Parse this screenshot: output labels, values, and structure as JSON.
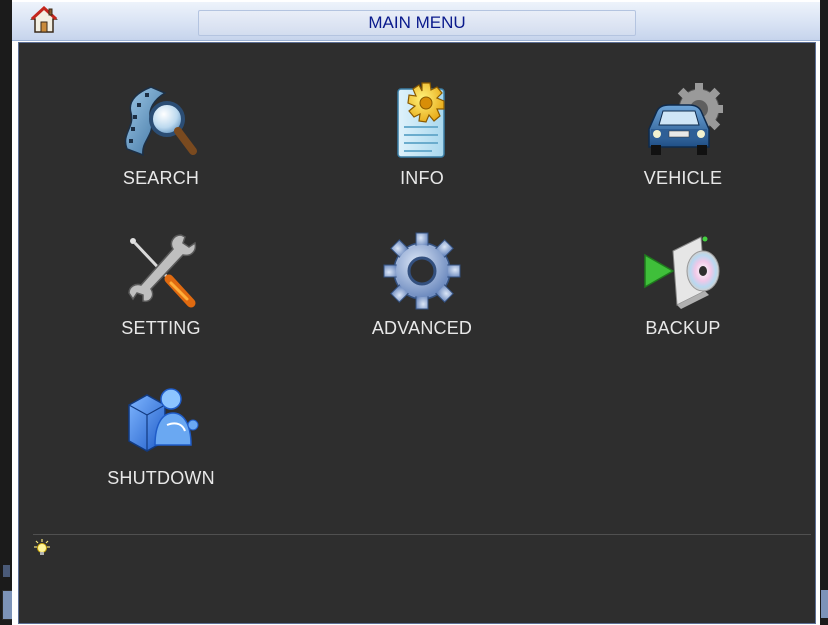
{
  "window": {
    "title": "MAIN MENU"
  },
  "menu": {
    "items": [
      {
        "label": "SEARCH",
        "icon": "search-icon"
      },
      {
        "label": "INFO",
        "icon": "info-icon"
      },
      {
        "label": "VEHICLE",
        "icon": "vehicle-icon"
      },
      {
        "label": "SETTING",
        "icon": "setting-icon"
      },
      {
        "label": "ADVANCED",
        "icon": "advanced-icon"
      },
      {
        "label": "BACKUP",
        "icon": "backup-icon"
      },
      {
        "label": "SHUTDOWN",
        "icon": "shutdown-icon"
      }
    ]
  },
  "status": {
    "hint_icon": "lightbulb-icon",
    "hint_text": ""
  },
  "colors": {
    "title_text": "#0a1a8c",
    "panel_background": "#2e2e2e",
    "label_text": "#e8e8e8"
  }
}
